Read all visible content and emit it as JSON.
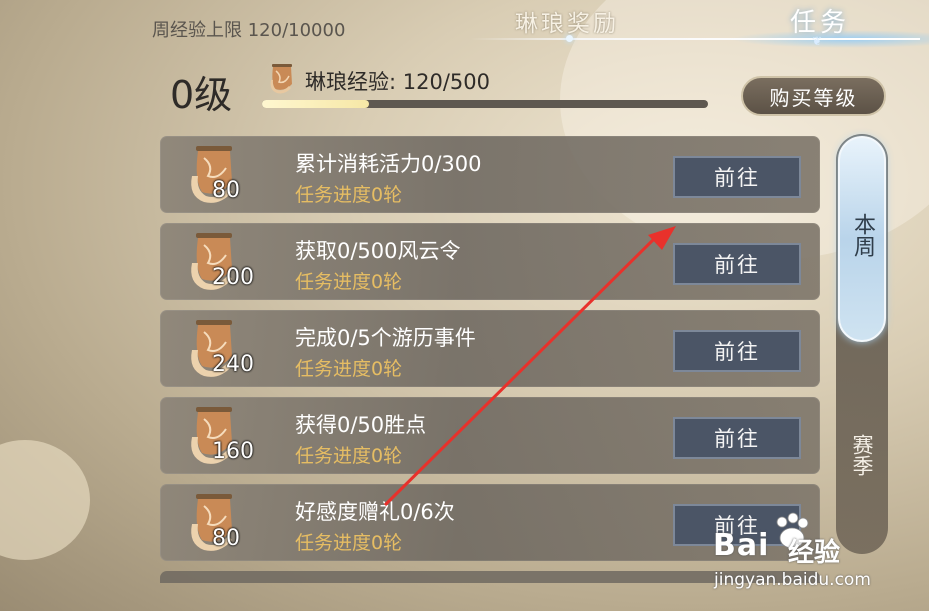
{
  "header": {
    "weekly_limit": "周经验上限 120/10000",
    "tabs": [
      {
        "label": "琳琅奖励",
        "active": false
      },
      {
        "label": "任务",
        "active": true
      }
    ]
  },
  "level_panel": {
    "level": "0级",
    "exp_label": "琳琅经验: 120/500",
    "exp_progress": 0.24,
    "buy_button": "购买等级",
    "icon": "banner-scroll-icon"
  },
  "tasks": [
    {
      "amount": "80",
      "title": "累计消耗活力0/300",
      "progress": "任务进度0轮",
      "button": "前往"
    },
    {
      "amount": "200",
      "title": "获取0/500风云令",
      "progress": "任务进度0轮",
      "button": "前往"
    },
    {
      "amount": "240",
      "title": "完成0/5个游历事件",
      "progress": "任务进度0轮",
      "button": "前往"
    },
    {
      "amount": "160",
      "title": "获得0/50胜点",
      "progress": "任务进度0轮",
      "button": "前往"
    },
    {
      "amount": "80",
      "title": "好感度赠礼0/6次",
      "progress": "任务进度0轮",
      "button": "前往"
    }
  ],
  "side_tabs": [
    {
      "label": "本周",
      "active": true
    },
    {
      "label": "赛季",
      "active": false
    }
  ],
  "annotation": {
    "type": "red-arrow",
    "color": "#e8312b"
  },
  "watermark": {
    "logo_left": "Bai",
    "logo_right": "经验",
    "url": "jingyan.baidu.com"
  },
  "colors": {
    "progress_text": "#e6bd63",
    "active_tab_glow": "#82c8ff",
    "button_bg": "#4b5566"
  }
}
